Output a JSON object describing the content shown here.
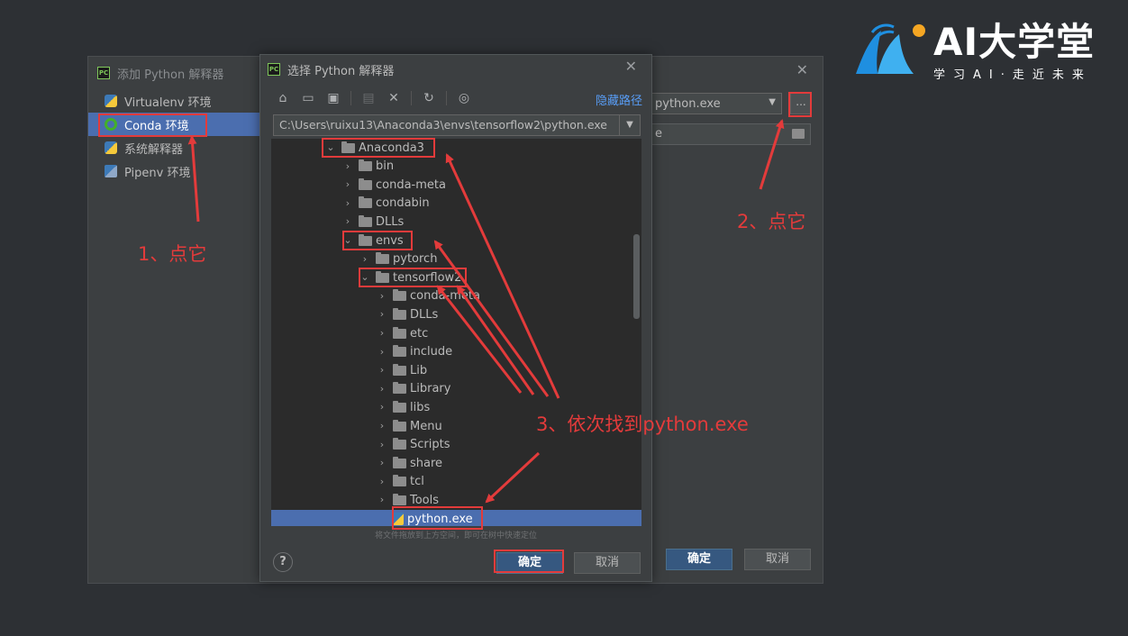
{
  "brand": {
    "title": "AI大学堂",
    "subtitle": "学习AI·走近未来"
  },
  "back_dialog": {
    "title": "添加 Python 解释器",
    "sidebar": [
      {
        "label": "Virtualenv 环境",
        "icon": "python-icon"
      },
      {
        "label": "Conda 环境",
        "icon": "conda-icon",
        "selected": true
      },
      {
        "label": "系统解释器",
        "icon": "python-icon"
      },
      {
        "label": "Pipenv 环境",
        "icon": "pipenv-icon"
      }
    ],
    "interpreter_value": "python.exe",
    "browse_label": "...",
    "conda_exe_value": "e",
    "ok_label": "确定",
    "cancel_label": "取消"
  },
  "front_dialog": {
    "title": "选择 Python 解释器",
    "hide_path_label": "隐藏路径",
    "path_value": "C:\\Users\\ruixu13\\Anaconda3\\envs\\tensorflow2\\python.exe",
    "tree": [
      {
        "label": "Anaconda3",
        "depth": 0,
        "type": "folder",
        "expanded": true
      },
      {
        "label": "bin",
        "depth": 1,
        "type": "folder"
      },
      {
        "label": "conda-meta",
        "depth": 1,
        "type": "folder"
      },
      {
        "label": "condabin",
        "depth": 1,
        "type": "folder"
      },
      {
        "label": "DLLs",
        "depth": 1,
        "type": "folder"
      },
      {
        "label": "envs",
        "depth": 1,
        "type": "folder",
        "expanded": true
      },
      {
        "label": "pytorch",
        "depth": 2,
        "type": "folder"
      },
      {
        "label": "tensorflow2",
        "depth": 2,
        "type": "folder",
        "expanded": true
      },
      {
        "label": "conda-meta",
        "depth": 3,
        "type": "folder"
      },
      {
        "label": "DLLs",
        "depth": 3,
        "type": "folder"
      },
      {
        "label": "etc",
        "depth": 3,
        "type": "folder"
      },
      {
        "label": "include",
        "depth": 3,
        "type": "folder"
      },
      {
        "label": "Lib",
        "depth": 3,
        "type": "folder"
      },
      {
        "label": "Library",
        "depth": 3,
        "type": "folder"
      },
      {
        "label": "libs",
        "depth": 3,
        "type": "folder"
      },
      {
        "label": "Menu",
        "depth": 3,
        "type": "folder"
      },
      {
        "label": "Scripts",
        "depth": 3,
        "type": "folder"
      },
      {
        "label": "share",
        "depth": 3,
        "type": "folder"
      },
      {
        "label": "tcl",
        "depth": 3,
        "type": "folder"
      },
      {
        "label": "Tools",
        "depth": 3,
        "type": "folder"
      },
      {
        "label": "python.exe",
        "depth": 3,
        "type": "python-file",
        "selected": true
      }
    ],
    "hint": "将文件拖放到上方空间，即可在树中快速定位",
    "help_label": "?",
    "ok_label": "确定",
    "cancel_label": "取消"
  },
  "annotations": {
    "step1": "1、点它",
    "step2": "2、点它",
    "step3": "3、依次找到python.exe",
    "color": "#e33b3b"
  }
}
